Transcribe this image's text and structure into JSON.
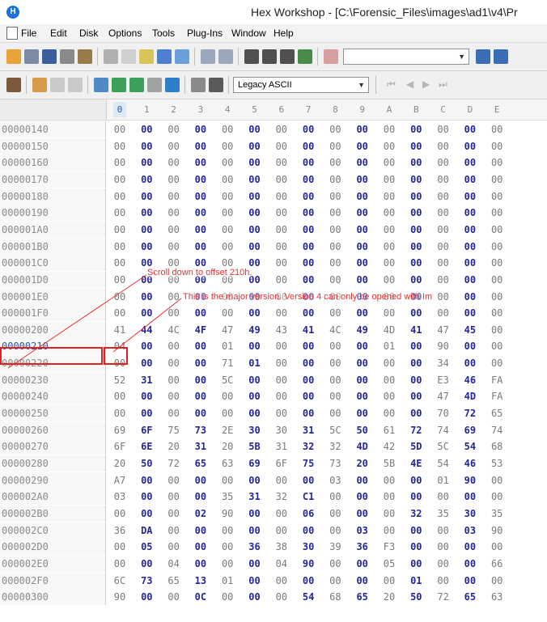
{
  "window": {
    "title": "Hex Workshop - [C:\\Forensic_Files\\images\\ad1\\v4\\Pr"
  },
  "menu": [
    "File",
    "Edit",
    "Disk",
    "Options",
    "Tools",
    "Plug-Ins",
    "Window",
    "Help"
  ],
  "toolbar": {
    "find_value": "",
    "encoding": "Legacy ASCII"
  },
  "columns": [
    "0",
    "1",
    "2",
    "3",
    "4",
    "5",
    "6",
    "7",
    "8",
    "9",
    "A",
    "B",
    "C",
    "D",
    "E"
  ],
  "rows": [
    {
      "offset": "00000140",
      "bytes": [
        "00",
        "00",
        "00",
        "00",
        "00",
        "00",
        "00",
        "00",
        "00",
        "00",
        "00",
        "00",
        "00",
        "00",
        "00"
      ]
    },
    {
      "offset": "00000150",
      "bytes": [
        "00",
        "00",
        "00",
        "00",
        "00",
        "00",
        "00",
        "00",
        "00",
        "00",
        "00",
        "00",
        "00",
        "00",
        "00"
      ]
    },
    {
      "offset": "00000160",
      "bytes": [
        "00",
        "00",
        "00",
        "00",
        "00",
        "00",
        "00",
        "00",
        "00",
        "00",
        "00",
        "00",
        "00",
        "00",
        "00"
      ]
    },
    {
      "offset": "00000170",
      "bytes": [
        "00",
        "00",
        "00",
        "00",
        "00",
        "00",
        "00",
        "00",
        "00",
        "00",
        "00",
        "00",
        "00",
        "00",
        "00"
      ]
    },
    {
      "offset": "00000180",
      "bytes": [
        "00",
        "00",
        "00",
        "00",
        "00",
        "00",
        "00",
        "00",
        "00",
        "00",
        "00",
        "00",
        "00",
        "00",
        "00"
      ]
    },
    {
      "offset": "00000190",
      "bytes": [
        "00",
        "00",
        "00",
        "00",
        "00",
        "00",
        "00",
        "00",
        "00",
        "00",
        "00",
        "00",
        "00",
        "00",
        "00"
      ]
    },
    {
      "offset": "000001A0",
      "bytes": [
        "00",
        "00",
        "00",
        "00",
        "00",
        "00",
        "00",
        "00",
        "00",
        "00",
        "00",
        "00",
        "00",
        "00",
        "00"
      ]
    },
    {
      "offset": "000001B0",
      "bytes": [
        "00",
        "00",
        "00",
        "00",
        "00",
        "00",
        "00",
        "00",
        "00",
        "00",
        "00",
        "00",
        "00",
        "00",
        "00"
      ]
    },
    {
      "offset": "000001C0",
      "bytes": [
        "00",
        "00",
        "00",
        "00",
        "00",
        "00",
        "00",
        "00",
        "00",
        "00",
        "00",
        "00",
        "00",
        "00",
        "00"
      ]
    },
    {
      "offset": "000001D0",
      "bytes": [
        "00",
        "00",
        "00",
        "00",
        "00",
        "00",
        "00",
        "00",
        "00",
        "00",
        "00",
        "00",
        "00",
        "00",
        "00"
      ]
    },
    {
      "offset": "000001E0",
      "bytes": [
        "00",
        "00",
        "00",
        "00",
        "00",
        "00",
        "00",
        "00",
        "00",
        "00",
        "00",
        "00",
        "00",
        "00",
        "00"
      ]
    },
    {
      "offset": "000001F0",
      "bytes": [
        "00",
        "00",
        "00",
        "00",
        "00",
        "00",
        "00",
        "00",
        "00",
        "00",
        "00",
        "00",
        "00",
        "00",
        "00"
      ]
    },
    {
      "offset": "00000200",
      "bytes": [
        "41",
        "44",
        "4C",
        "4F",
        "47",
        "49",
        "43",
        "41",
        "4C",
        "49",
        "4D",
        "41",
        "47",
        "45",
        "00"
      ]
    },
    {
      "offset": "00000210",
      "bytes": [
        "04",
        "00",
        "00",
        "00",
        "01",
        "00",
        "00",
        "00",
        "00",
        "00",
        "01",
        "00",
        "90",
        "00",
        "00"
      ]
    },
    {
      "offset": "00000220",
      "bytes": [
        "00",
        "00",
        "00",
        "00",
        "71",
        "01",
        "00",
        "00",
        "00",
        "00",
        "00",
        "00",
        "34",
        "00",
        "00"
      ]
    },
    {
      "offset": "00000230",
      "bytes": [
        "52",
        "31",
        "00",
        "00",
        "5C",
        "00",
        "00",
        "00",
        "00",
        "00",
        "00",
        "00",
        "E3",
        "46",
        "FA"
      ]
    },
    {
      "offset": "00000240",
      "bytes": [
        "00",
        "00",
        "00",
        "00",
        "00",
        "00",
        "00",
        "00",
        "00",
        "00",
        "00",
        "00",
        "47",
        "4D",
        "FA"
      ]
    },
    {
      "offset": "00000250",
      "bytes": [
        "00",
        "00",
        "00",
        "00",
        "00",
        "00",
        "00",
        "00",
        "00",
        "00",
        "00",
        "00",
        "70",
        "72",
        "65"
      ]
    },
    {
      "offset": "00000260",
      "bytes": [
        "69",
        "6F",
        "75",
        "73",
        "2E",
        "30",
        "30",
        "31",
        "5C",
        "50",
        "61",
        "72",
        "74",
        "69",
        "74"
      ]
    },
    {
      "offset": "00000270",
      "bytes": [
        "6F",
        "6E",
        "20",
        "31",
        "20",
        "5B",
        "31",
        "32",
        "32",
        "4D",
        "42",
        "5D",
        "5C",
        "54",
        "68"
      ]
    },
    {
      "offset": "00000280",
      "bytes": [
        "20",
        "50",
        "72",
        "65",
        "63",
        "69",
        "6F",
        "75",
        "73",
        "20",
        "5B",
        "4E",
        "54",
        "46",
        "53"
      ]
    },
    {
      "offset": "00000290",
      "bytes": [
        "A7",
        "00",
        "00",
        "00",
        "00",
        "00",
        "00",
        "00",
        "03",
        "00",
        "00",
        "00",
        "01",
        "90",
        "00"
      ]
    },
    {
      "offset": "000002A0",
      "bytes": [
        "03",
        "00",
        "00",
        "00",
        "35",
        "31",
        "32",
        "C1",
        "00",
        "00",
        "00",
        "00",
        "00",
        "00",
        "00"
      ]
    },
    {
      "offset": "000002B0",
      "bytes": [
        "00",
        "00",
        "00",
        "02",
        "90",
        "00",
        "00",
        "06",
        "00",
        "00",
        "00",
        "32",
        "35",
        "30",
        "35"
      ]
    },
    {
      "offset": "000002C0",
      "bytes": [
        "36",
        "DA",
        "00",
        "00",
        "00",
        "00",
        "00",
        "00",
        "00",
        "03",
        "00",
        "00",
        "00",
        "03",
        "90"
      ]
    },
    {
      "offset": "000002D0",
      "bytes": [
        "00",
        "05",
        "00",
        "00",
        "00",
        "36",
        "38",
        "30",
        "39",
        "36",
        "F3",
        "00",
        "00",
        "00",
        "00"
      ]
    },
    {
      "offset": "000002E0",
      "bytes": [
        "00",
        "00",
        "04",
        "00",
        "00",
        "00",
        "04",
        "90",
        "00",
        "00",
        "05",
        "00",
        "00",
        "00",
        "66"
      ]
    },
    {
      "offset": "000002F0",
      "bytes": [
        "6C",
        "73",
        "65",
        "13",
        "01",
        "00",
        "00",
        "00",
        "00",
        "00",
        "00",
        "01",
        "00",
        "00",
        "00"
      ]
    },
    {
      "offset": "00000300",
      "bytes": [
        "90",
        "00",
        "00",
        "0C",
        "00",
        "00",
        "00",
        "54",
        "68",
        "65",
        "20",
        "50",
        "72",
        "65",
        "63"
      ]
    }
  ],
  "annotations": {
    "scroll_note": "Scroll down to offset 210h.",
    "version_note": "This is the major version.  Version 4 can only be opened with Im"
  },
  "colors": {
    "annotation": "#e02020",
    "byte_dark": "#262699",
    "byte_light": "#7a7a7a"
  }
}
